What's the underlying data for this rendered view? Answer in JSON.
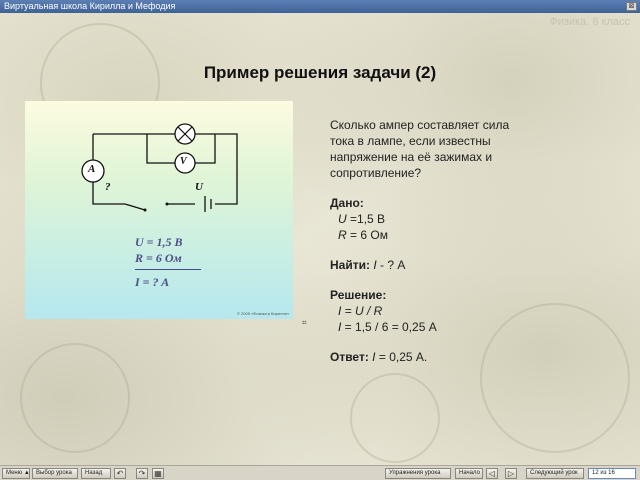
{
  "window": {
    "title": "Виртуальная школа Кирилла и Мефодия",
    "close_symbol": "⊠"
  },
  "slide": {
    "grade": "Физика. 8 класс",
    "title": "Пример решения задачи (2)"
  },
  "circuit": {
    "ammeter": "A",
    "voltmeter": "V",
    "question_mark": "?",
    "voltage_label": "U",
    "formula_u": "U = 1,5 В",
    "formula_r": "R = 6 Ом",
    "formula_i": "I = ? A",
    "copyright": "© 2005 «Физика в Кирилле»"
  },
  "task": {
    "question": "Сколько ампер составляет сила тока в лампе, если известны напряжение на её зажимах и сопротивление?",
    "given_label": "Дано:",
    "given_u_sym": "U",
    "given_u_val": " =1,5 В",
    "given_r_sym": "R",
    "given_r_val": " = 6 Ом",
    "find_label": "Найти:",
    "find_sym": "I",
    "find_val": " - ? А",
    "solution_label": "Решение:",
    "sol1": "I = U / R",
    "sol2_sym": "I",
    "sol2_val": " = 1,5 / 6 = 0,25 А",
    "answer_label": "Ответ:",
    "answer_sym": "I",
    "answer_val": " = 0,25 А."
  },
  "toolbar": {
    "menu": "Меню ▲",
    "choose_lesson": "Выбор урока",
    "back": "Назад",
    "back_icon": "↶",
    "forward_icon": "↷",
    "grid_icon": "▦",
    "exercises": "Упражнения урока",
    "start": "Начало",
    "prev_icon": "◁",
    "next_icon": "▷",
    "next_lesson": "Следующий урок",
    "time": "12 из 16"
  },
  "colors": {
    "title_bar": "#3f6296",
    "formula": "#4d4d88"
  }
}
